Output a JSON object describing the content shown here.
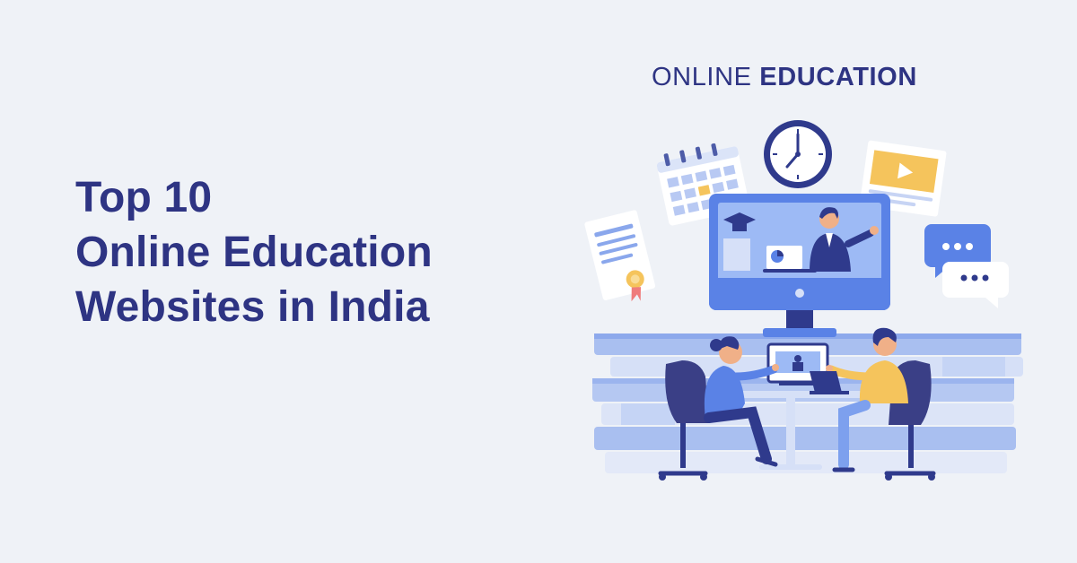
{
  "headline": {
    "line1": "Top 10",
    "line2": "Online Education",
    "line3": "Websites in India"
  },
  "brand": {
    "light": "ONLINE",
    "bold": "EDUCATION"
  },
  "colors": {
    "background": "#eff2f7",
    "primary_text": "#2e3483",
    "accent_blue": "#5a82e6",
    "light_blue": "#a9bff0",
    "yellow": "#f5c45c",
    "chair_navy": "#3a3f86"
  },
  "illustration": {
    "icons": [
      "calendar-icon",
      "clock-icon",
      "video-player-icon",
      "certificate-icon",
      "chat-bubble-icon",
      "graduation-cap-icon",
      "monitor-icon",
      "laptop-icon",
      "books-stack-icon"
    ]
  }
}
